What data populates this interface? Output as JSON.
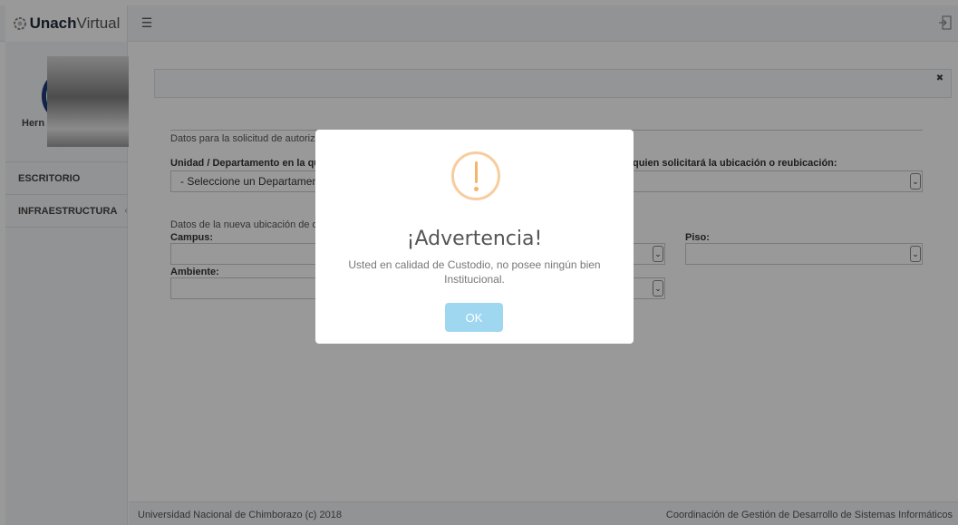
{
  "brand": {
    "bold": "Unach",
    "light": "Virtual"
  },
  "header": {
    "menu_icon": "hamburger-icon",
    "logout_icon": "logout-icon"
  },
  "sidebar": {
    "user_name": "Hern",
    "items": [
      {
        "label": "ESCRITORIO"
      },
      {
        "label": "INFRAESTRUCTURA",
        "chevron": "‹"
      }
    ]
  },
  "form": {
    "section1": "Datos para la solicitud de autorizaci",
    "unit_label": "Unidad / Departamento en la que",
    "unit_select": "- Seleccione un Departamento",
    "requester_label": "quien solicitará la ubicación o reubicación:",
    "section2": "Datos de la nueva ubicación de o los",
    "campus_label": "Campus:",
    "floor_label": "Piso:",
    "ambiente_label": "Ambiente:"
  },
  "modal": {
    "icon": "warning-icon",
    "title": "¡Advertencia!",
    "text": "Usted en calidad de Custodio, no posee ningún bien Institucional.",
    "ok": "OK",
    "ok_color": "#9fd7f0",
    "icon_color": "#f8cc9e"
  },
  "footer": {
    "left": "Universidad Nacional de Chimborazo (c) 2018",
    "right": "Coordinación de Gestión de Desarrollo de Sistemas Informáticos"
  }
}
